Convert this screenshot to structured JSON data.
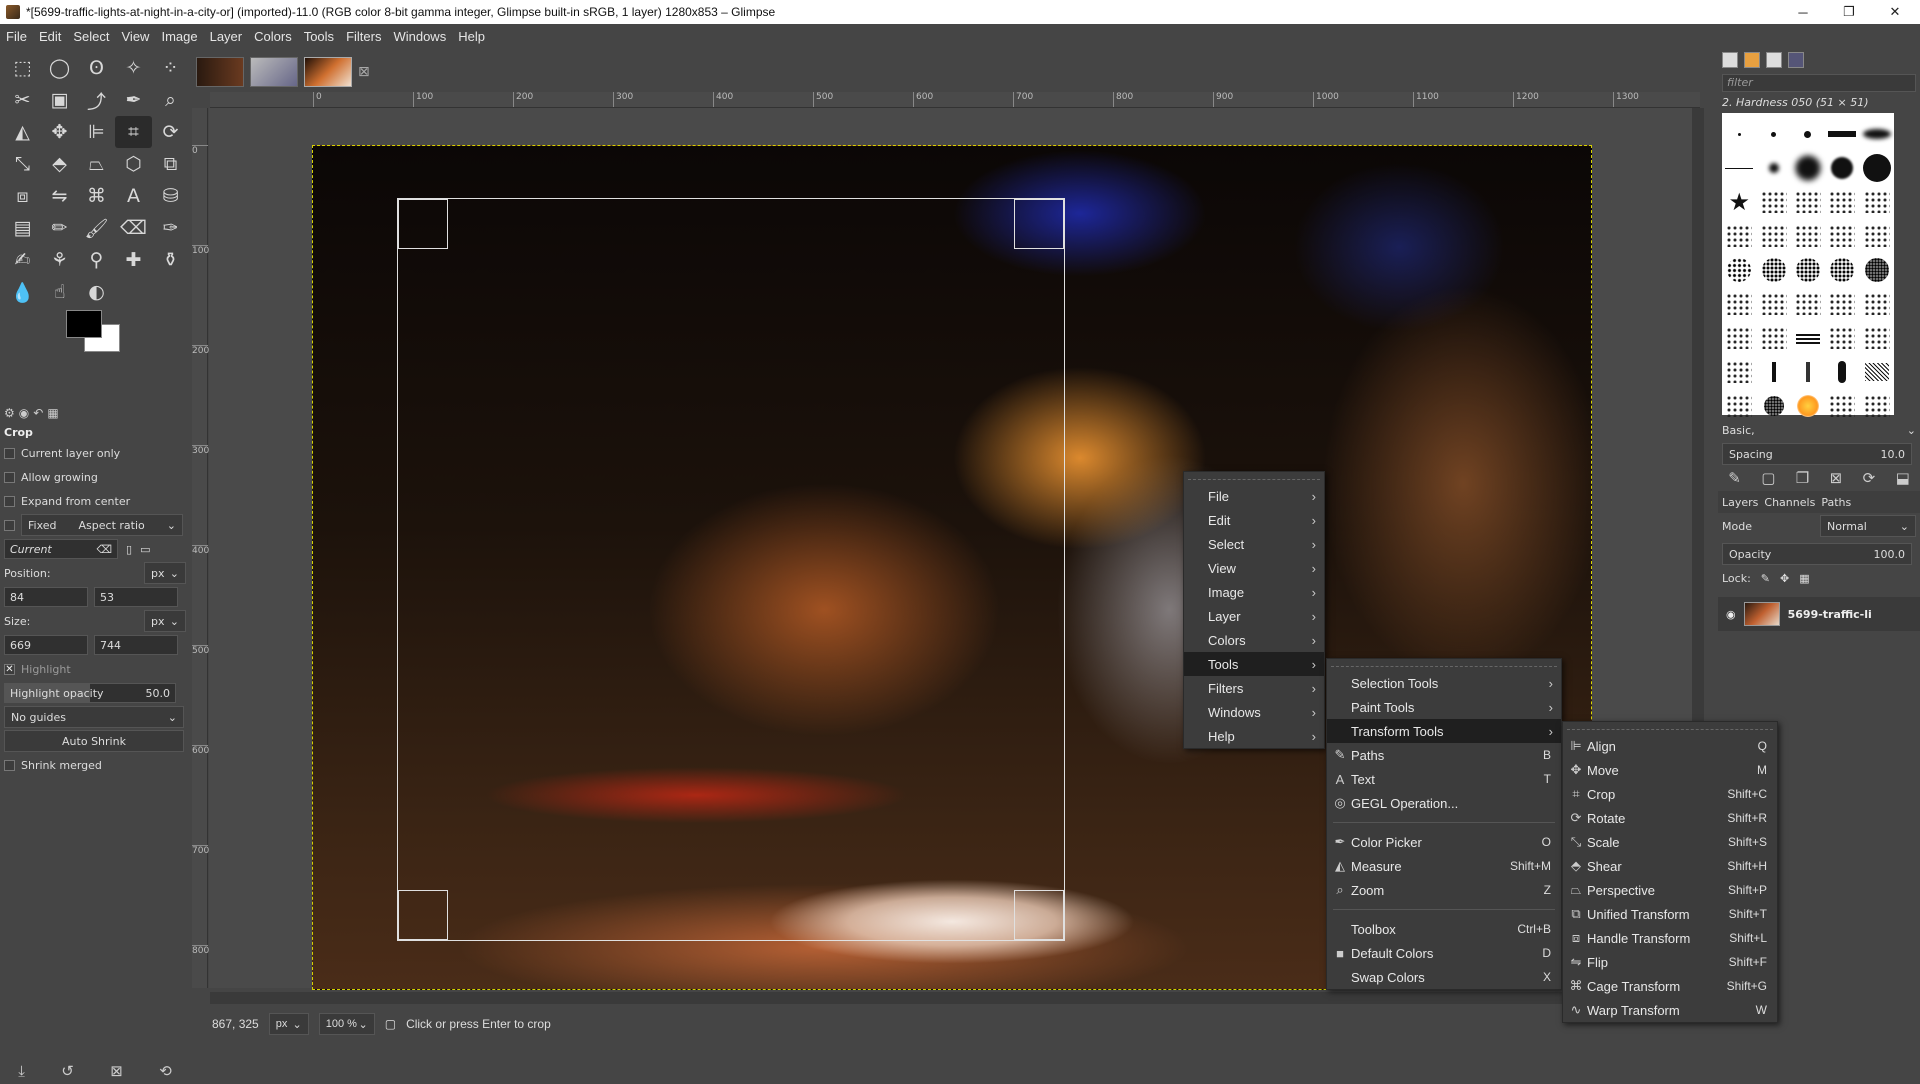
{
  "window": {
    "title": "*[5699-traffic-lights-at-night-in-a-city-or] (imported)-11.0 (RGB color 8-bit gamma integer, Glimpse built-in sRGB, 1 layer) 1280x853 – Glimpse"
  },
  "menubar": [
    "File",
    "Edit",
    "Select",
    "View",
    "Image",
    "Layer",
    "Colors",
    "Tools",
    "Filters",
    "Windows",
    "Help"
  ],
  "tool_options": {
    "title": "Crop",
    "current_layer_only": "Current layer only",
    "allow_growing": "Allow growing",
    "expand_from_center": "Expand from center",
    "fixed": "Fixed",
    "aspect": "Aspect ratio",
    "current": "Current",
    "position_label": "Position:",
    "position_unit": "px",
    "pos_x": "84",
    "pos_y": "53",
    "size_label": "Size:",
    "size_unit": "px",
    "size_w": "669",
    "size_h": "744",
    "highlight": "Highlight",
    "highlight_opacity_label": "Highlight opacity",
    "highlight_opacity": "50.0",
    "guides": "No guides",
    "auto_shrink": "Auto Shrink",
    "shrink_merged": "Shrink merged"
  },
  "ruler_h": [
    "0",
    "100",
    "200",
    "300",
    "400",
    "500",
    "600",
    "700",
    "800",
    "900",
    "1000",
    "1100",
    "1200",
    "1300"
  ],
  "ruler_v": [
    "0",
    "100",
    "200",
    "300",
    "400",
    "500",
    "600",
    "700",
    "800"
  ],
  "statusbar": {
    "coords": "867, 325",
    "unit": "px",
    "zoom": "100 %",
    "message": "Click or press Enter to crop"
  },
  "dock": {
    "filter_placeholder": "filter",
    "brush_name": "2. Hardness 050 (51 × 51)",
    "preset": "Basic,",
    "spacing_label": "Spacing",
    "spacing_value": "10.0",
    "tab_layers": "Layers",
    "tab_channels": "Channels",
    "tab_paths": "Paths",
    "mode_label": "Mode",
    "mode_value": "Normal",
    "opacity_label": "Opacity",
    "opacity_value": "100.0",
    "lock_label": "Lock:",
    "layer_name": "5699-traffic-li"
  },
  "menu_main": [
    "File",
    "Edit",
    "Select",
    "View",
    "Image",
    "Layer",
    "Colors",
    "Tools",
    "Filters",
    "Windows",
    "Help"
  ],
  "menu_tools": {
    "sub1": [
      "Selection Tools",
      "Paint Tools",
      "Transform Tools"
    ],
    "items": [
      {
        "label": "Paths",
        "sc": "B",
        "icon": "✎"
      },
      {
        "label": "Text",
        "sc": "T",
        "icon": "A"
      },
      {
        "label": "GEGL Operation...",
        "sc": "",
        "icon": "◎"
      }
    ],
    "items2": [
      {
        "label": "Color Picker",
        "sc": "O",
        "icon": "✒"
      },
      {
        "label": "Measure",
        "sc": "Shift+M",
        "icon": "◭"
      },
      {
        "label": "Zoom",
        "sc": "Z",
        "icon": "⌕"
      }
    ],
    "items3": [
      {
        "label": "Toolbox",
        "sc": "Ctrl+B",
        "icon": ""
      },
      {
        "label": "Default Colors",
        "sc": "D",
        "icon": "■"
      },
      {
        "label": "Swap Colors",
        "sc": "X",
        "icon": ""
      }
    ]
  },
  "menu_transform": [
    {
      "label": "Align",
      "sc": "Q"
    },
    {
      "label": "Move",
      "sc": "M"
    },
    {
      "label": "Crop",
      "sc": "Shift+C"
    },
    {
      "label": "Rotate",
      "sc": "Shift+R"
    },
    {
      "label": "Scale",
      "sc": "Shift+S"
    },
    {
      "label": "Shear",
      "sc": "Shift+H"
    },
    {
      "label": "Perspective",
      "sc": "Shift+P"
    },
    {
      "label": "Unified Transform",
      "sc": "Shift+T"
    },
    {
      "label": "Handle Transform",
      "sc": "Shift+L"
    },
    {
      "label": "Flip",
      "sc": "Shift+F"
    },
    {
      "label": "Cage Transform",
      "sc": "Shift+G"
    },
    {
      "label": "Warp Transform",
      "sc": "W"
    }
  ],
  "colors": {
    "accent": "#d6d200",
    "menu_bg": "#3c3c3c",
    "menu_highlight": "#1f1f1f",
    "ui_bg": "#454545"
  }
}
